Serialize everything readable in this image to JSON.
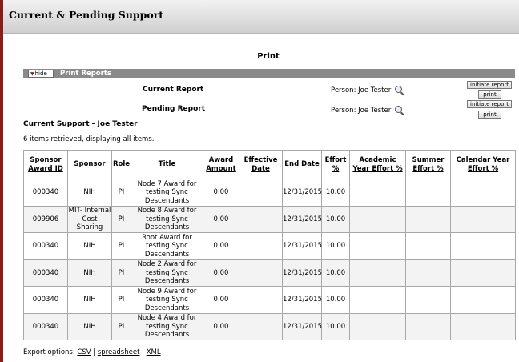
{
  "header": {
    "title": "Current & Pending Support"
  },
  "print_title": "Print",
  "reports_bar": {
    "hide_label": "hide",
    "title": "Print Reports"
  },
  "current_report": {
    "label": "Current Report",
    "person": "Person: Joe Tester",
    "initiate_label": "initiate report",
    "print_label": "print"
  },
  "pending_report": {
    "label": "Pending Report",
    "person": "Person: Joe Tester",
    "initiate_label": "initiate report",
    "print_label": "print"
  },
  "support_title": "Current Support - Joe Tester",
  "retrieved_text": "6 items retrieved, displaying all items.",
  "table": {
    "headers": [
      "Sponsor Award ID",
      "Sponsor",
      "Role",
      "Title",
      "Award Amount",
      "Effective Date",
      "End Date",
      "Effort %",
      "Academic Year Effort %",
      "Summer Effort %",
      "Calendar Year Effort %"
    ],
    "rows": [
      [
        "000340",
        "NIH",
        "PI",
        "Node 7 Award for testing Sync Descendants",
        "0.00",
        "",
        "12/31/2015",
        "10.00",
        "",
        "",
        ""
      ],
      [
        "009906",
        "MIT- Internal Cost Sharing",
        "PI",
        "Node 8 Award for testing Sync Descendants",
        "0.00",
        "",
        "12/31/2015",
        "10.00",
        "",
        "",
        ""
      ],
      [
        "000340",
        "NIH",
        "PI",
        "Root Award for testing Sync Descendants",
        "0.00",
        "",
        "12/31/2015",
        "10.00",
        "",
        "",
        ""
      ],
      [
        "000340",
        "NIH",
        "PI",
        "Node 2 Award for testing Sync Descendants",
        "0.00",
        "",
        "12/31/2015",
        "10.00",
        "",
        "",
        ""
      ],
      [
        "000340",
        "NIH",
        "PI",
        "Node 9 Award for testing Sync Descendants",
        "0.00",
        "",
        "12/31/2015",
        "10.00",
        "",
        "",
        ""
      ],
      [
        "000340",
        "NIH",
        "PI",
        "Node 4 Award for testing Sync Descendants",
        "0.00",
        "",
        "12/31/2015",
        "10.00",
        "",
        "",
        ""
      ]
    ]
  },
  "export": {
    "label": "Export options:",
    "csv": "CSV",
    "spreadsheet": "spreadsheet",
    "xml": "XML",
    "separator": "|"
  },
  "colors": {
    "accent_border": "#8b1a1a",
    "bar_bg": "#8a8a8a"
  },
  "icons": {
    "lookup": "magnifier-icon",
    "hide": "triangle-down-icon"
  }
}
